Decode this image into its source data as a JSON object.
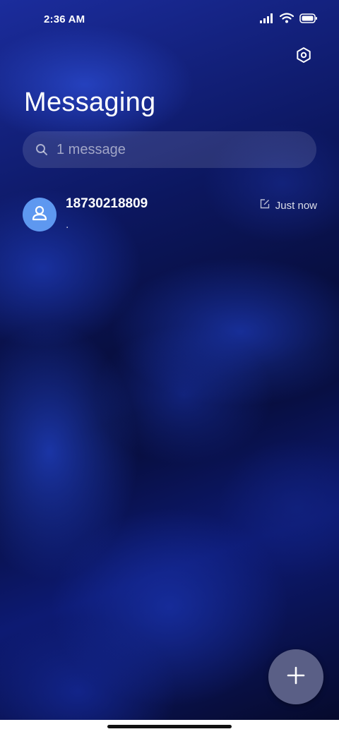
{
  "status_bar": {
    "time": "2:36 AM",
    "icons": [
      "signal-icon",
      "wifi-icon",
      "battery-icon"
    ]
  },
  "header": {
    "title": "Messaging",
    "settings_icon": "settings-icon"
  },
  "search": {
    "placeholder": "1 message",
    "icon": "search-icon"
  },
  "conversations": [
    {
      "sender": "18730218809",
      "preview": ".",
      "time": "Just now",
      "status_icon": "draft-icon",
      "avatar_icon": "person-icon",
      "avatar_color": "#5e98f0"
    }
  ],
  "fab": {
    "icon": "plus-icon",
    "color": "#5a5f86"
  },
  "colors": {
    "background_primary": "#0c1760",
    "background_accent": "#1b2c9c"
  }
}
